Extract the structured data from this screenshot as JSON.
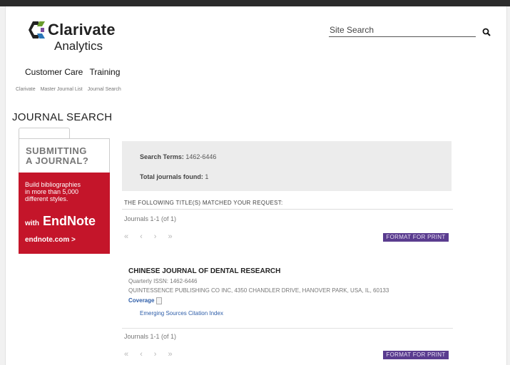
{
  "header": {
    "logo_line1": "Clarivate",
    "logo_line2": "Analytics",
    "search_label": "Site Search"
  },
  "nav": {
    "items": [
      "Customer Care",
      "Training"
    ]
  },
  "breadcrumb": [
    "Clarivate",
    "Master Journal List",
    "Journal Search"
  ],
  "page_title": "JOURNAL SEARCH",
  "ad": {
    "headline_1": "SUBMITTING",
    "headline_2": "A JOURNAL?",
    "body_1": "Build bibliographies",
    "body_2": "in more than 5,000",
    "body_3": "different styles.",
    "with": "with",
    "brand": "EndNote",
    "url": "endnote.com  >"
  },
  "summary": {
    "terms_label": "Search Terms:",
    "terms_value": "1462-6446",
    "found_label": "Total journals found:",
    "found_value": "1"
  },
  "matched_text": "THE FOLLOWING TITLE(S) MATCHED YOUR REQUEST:",
  "pagination": {
    "count": "Journals 1-1 (of 1)",
    "first": "«",
    "prev": "‹",
    "next": "›",
    "last": "»",
    "format_button": "FORMAT FOR PRINT"
  },
  "result": {
    "title": "CHINESE JOURNAL OF DENTAL RESEARCH",
    "issn": "Quarterly ISSN: 1462-6446",
    "publisher": "QUINTESSENCE PUBLISHING CO INC, 4350 CHANDLER DRIVE, HANOVER PARK, USA, IL, 60133",
    "coverage_label": "Coverage",
    "index": "Emerging Sources Citation Index"
  },
  "colors": {
    "accent_red": "#c4152a",
    "button_purple": "#5a3c8f",
    "link_blue": "#2d5da8"
  }
}
